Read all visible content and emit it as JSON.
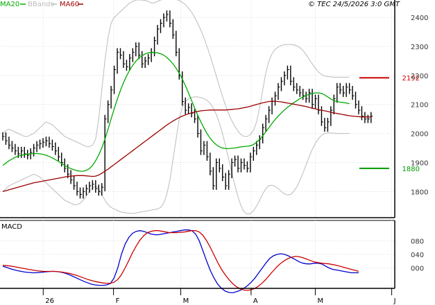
{
  "chart_data": [
    {
      "type": "line",
      "panel": "price",
      "legend": [
        {
          "name": "MA20",
          "color": "#00aa00"
        },
        {
          "name": "BBands",
          "color": "#bbbbbb"
        },
        {
          "name": "MA60",
          "color": "#990000"
        }
      ],
      "copyright": "© TEC 24/5/2026 3:0 GMT",
      "y_ticks": [
        "2400",
        "2300",
        "2200",
        "2100",
        "2000",
        "1900",
        "1800"
      ],
      "y_tick_values": [
        2400,
        2300,
        2200,
        2100,
        2000,
        1900,
        1800
      ],
      "ylim": [
        1710,
        2460
      ],
      "x_ticks": [
        "26",
        "F",
        "M",
        "A",
        "M",
        "J"
      ],
      "x_tick_index": [
        13,
        36,
        58,
        81,
        102,
        127
      ],
      "x_range": [
        0,
        128
      ],
      "grid": true,
      "resistance": {
        "value": 2192,
        "label": "2192",
        "color": "#cc0000"
      },
      "support": {
        "value": 1880,
        "label": "1880",
        "color": "#009900"
      },
      "series": [
        {
          "name": "Price",
          "color": "#000000",
          "values": [
            1990,
            1975,
            1960,
            1950,
            1940,
            1930,
            1940,
            1930,
            1925,
            1935,
            1950,
            1960,
            1965,
            1970,
            1975,
            1965,
            1955,
            1940,
            1920,
            1900,
            1880,
            1860,
            1840,
            1820,
            1800,
            1790,
            1800,
            1810,
            1820,
            1825,
            1810,
            1800,
            1815,
            2050,
            2100,
            2150,
            2220,
            2280,
            2270,
            2240,
            2230,
            2260,
            2280,
            2300,
            2270,
            2240,
            2250,
            2260,
            2280,
            2320,
            2360,
            2380,
            2400,
            2410,
            2380,
            2340,
            2280,
            2200,
            2110,
            2080,
            2090,
            2070,
            2050,
            2000,
            1940,
            1960,
            1920,
            1870,
            1820,
            1900,
            1880,
            1850,
            1820,
            1860,
            1900,
            1910,
            1880,
            1900,
            1890,
            1880,
            1920,
            1940,
            1960,
            1980,
            2020,
            2050,
            2080,
            2110,
            2130,
            2160,
            2180,
            2200,
            2220,
            2180,
            2160,
            2150,
            2140,
            2130,
            2120,
            2140,
            2100,
            2120,
            2080,
            2040,
            2020,
            2040,
            2080,
            2120,
            2160,
            2150,
            2140,
            2160,
            2150,
            2130,
            2100,
            2080,
            2060,
            2050,
            2050,
            2060
          ]
        },
        {
          "name": "MA20",
          "color": "#00aa00",
          "values": [
            1890,
            1898,
            1906,
            1912,
            1918,
            1922,
            1925,
            1927,
            1929,
            1930,
            1931,
            1931,
            1930,
            1928,
            1925,
            1921,
            1916,
            1910,
            1904,
            1897,
            1890,
            1884,
            1879,
            1875,
            1872,
            1870,
            1870,
            1873,
            1879,
            1890,
            1906,
            1926,
            1950,
            1980,
            2015,
            2050,
            2085,
            2118,
            2148,
            2175,
            2198,
            2218,
            2235,
            2249,
            2260,
            2268,
            2274,
            2278,
            2279,
            2279,
            2278,
            2275,
            2270,
            2262,
            2252,
            2240,
            2225,
            2208,
            2188,
            2165,
            2140,
            2114,
            2088,
            2063,
            2040,
            2019,
            2000,
            1984,
            1971,
            1961,
            1954,
            1950,
            1948,
            1948,
            1949,
            1950,
            1952,
            1954,
            1955,
            1956,
            1958,
            1962,
            1970,
            1980,
            1992,
            2006,
            2020,
            2035,
            2048,
            2060,
            2071,
            2081,
            2090,
            2098,
            2106,
            2113,
            2120,
            2126,
            2131,
            2135,
            2138,
            2140,
            2140,
            2138,
            2133,
            2126,
            2119,
            2113,
            2110,
            2108,
            2107,
            2105,
            2103
          ]
        },
        {
          "name": "MA60",
          "color": "#990000",
          "values": [
            1800,
            1803,
            1806,
            1809,
            1812,
            1815,
            1818,
            1821,
            1824,
            1827,
            1830,
            1832,
            1834,
            1836,
            1838,
            1840,
            1842,
            1844,
            1846,
            1848,
            1850,
            1852,
            1853,
            1854,
            1855,
            1855,
            1855,
            1854,
            1853,
            1852,
            1853,
            1857,
            1863,
            1870,
            1877,
            1885,
            1893,
            1901,
            1909,
            1917,
            1925,
            1933,
            1941,
            1949,
            1957,
            1965,
            1973,
            1981,
            1989,
            1997,
            2005,
            2013,
            2021,
            2029,
            2036,
            2043,
            2049,
            2055,
            2060,
            2064,
            2068,
            2071,
            2074,
            2076,
            2078,
            2079,
            2080,
            2081,
            2081,
            2081,
            2081,
            2081,
            2081,
            2082,
            2083,
            2084,
            2085,
            2087,
            2089,
            2091,
            2094,
            2097,
            2100,
            2103,
            2106,
            2108,
            2110,
            2111,
            2111,
            2110,
            2109,
            2107,
            2105,
            2103,
            2101,
            2099,
            2097,
            2095,
            2093,
            2090,
            2087,
            2085,
            2082,
            2080,
            2078,
            2076,
            2073,
            2071,
            2069,
            2067,
            2065,
            2063,
            2061,
            2060,
            2059,
            2058,
            2057,
            2057,
            2057,
            2057
          ]
        },
        {
          "name": "BBands upper",
          "color": "#bbbbbb",
          "values": [
            2000,
            2010,
            2015,
            2010,
            2005,
            2000,
            1995,
            1990,
            1990,
            1995,
            2000,
            2010,
            2020,
            2030,
            2040,
            2035,
            2030,
            2020,
            2010,
            2000,
            1990,
            1985,
            1980,
            1975,
            1970,
            1965,
            1960,
            1955,
            1955,
            1960,
            1980,
            2050,
            2150,
            2250,
            2330,
            2380,
            2400,
            2410,
            2420,
            2430,
            2440,
            2450,
            2455,
            2460,
            2460,
            2460,
            2458,
            2455,
            2450,
            2450,
            2455,
            2460,
            2462,
            2464,
            2465,
            2464,
            2462,
            2458,
            2452,
            2444,
            2432,
            2418,
            2400,
            2380,
            2356,
            2330,
            2300,
            2268,
            2234,
            2198,
            2162,
            2128,
            2096,
            2068,
            2044,
            2024,
            2008,
            1996,
            1990,
            1990,
            1996,
            2010,
            2040,
            2090,
            2150,
            2210,
            2250,
            2275,
            2290,
            2298,
            2303,
            2306,
            2307,
            2307,
            2306,
            2302,
            2296,
            2286,
            2272,
            2256,
            2240,
            2225,
            2212,
            2203,
            2198,
            2196,
            2195,
            2194,
            2194,
            2194,
            2194,
            2194,
            2194
          ]
        },
        {
          "name": "BBands lower",
          "color": "#bbbbbb",
          "values": [
            1800,
            1810,
            1820,
            1825,
            1830,
            1835,
            1840,
            1845,
            1850,
            1855,
            1860,
            1855,
            1850,
            1840,
            1830,
            1820,
            1810,
            1800,
            1790,
            1780,
            1770,
            1765,
            1760,
            1755,
            1755,
            1760,
            1770,
            1785,
            1800,
            1810,
            1820,
            1810,
            1790,
            1770,
            1755,
            1745,
            1740,
            1735,
            1730,
            1728,
            1726,
            1725,
            1725,
            1726,
            1728,
            1730,
            1732,
            1734,
            1736,
            1738,
            1740,
            1745,
            1760,
            1790,
            1840,
            1910,
            1980,
            2050,
            2090,
            2110,
            2120,
            2124,
            2126,
            2126,
            2124,
            2120,
            2114,
            2104,
            2088,
            2066,
            2036,
            1999,
            1957,
            1912,
            1866,
            1822,
            1782,
            1750,
            1730,
            1722,
            1724,
            1734,
            1750,
            1770,
            1792,
            1810,
            1820,
            1822,
            1818,
            1810,
            1800,
            1792,
            1788,
            1790,
            1800,
            1816,
            1838,
            1864,
            1892,
            1920,
            1945,
            1966,
            1982,
            1994,
            2000,
            2002,
            2002,
            2001,
            2000,
            2000,
            2000,
            2000,
            2000
          ]
        }
      ]
    },
    {
      "type": "line",
      "panel": "macd",
      "title": "MACD",
      "y_ticks": [
        "080",
        "040",
        "000"
      ],
      "y_tick_values": [
        80,
        40,
        0
      ],
      "ylim": [
        -60,
        140
      ],
      "grid": true,
      "series": [
        {
          "name": "MACD",
          "color": "#0000cc",
          "values": [
            5,
            2,
            -2,
            -5,
            -8,
            -10,
            -12,
            -13,
            -14,
            -14,
            -13,
            -12,
            -11,
            -10,
            -10,
            -11,
            -13,
            -16,
            -20,
            -25,
            -30,
            -35,
            -40,
            -44,
            -48,
            -50,
            -51,
            -51,
            -50,
            -46,
            -30,
            0,
            40,
            70,
            90,
            102,
            108,
            110,
            108,
            104,
            100,
            98,
            98,
            100,
            102,
            104,
            106,
            108,
            110,
            112,
            112,
            110,
            100,
            80,
            50,
            20,
            -8,
            -30,
            -48,
            -60,
            -68,
            -72,
            -73,
            -70,
            -66,
            -60,
            -52,
            -42,
            -30,
            -15,
            0,
            15,
            28,
            36,
            40,
            42,
            40,
            36,
            30,
            24,
            18,
            14,
            12,
            12,
            14,
            14,
            12,
            6,
            0,
            -4,
            -6,
            -8,
            -10,
            -12,
            -14,
            -14,
            -14
          ]
        },
        {
          "name": "Signal",
          "color": "#cc0000",
          "values": [
            8,
            7,
            6,
            4,
            2,
            0,
            -2,
            -4,
            -6,
            -8,
            -9,
            -10,
            -10,
            -10,
            -10,
            -11,
            -12,
            -14,
            -16,
            -19,
            -22,
            -26,
            -30,
            -34,
            -37,
            -40,
            -42,
            -44,
            -45,
            -45,
            -42,
            -34,
            -20,
            0,
            22,
            45,
            65,
            82,
            95,
            104,
            108,
            110,
            110,
            108,
            106,
            104,
            104,
            104,
            105,
            106,
            108,
            110,
            110,
            106,
            96,
            80,
            60,
            38,
            16,
            -4,
            -20,
            -34,
            -46,
            -55,
            -61,
            -65,
            -66,
            -64,
            -60,
            -53,
            -44,
            -33,
            -20,
            -8,
            4,
            14,
            22,
            28,
            32,
            34,
            33,
            30,
            26,
            22,
            18,
            16,
            14,
            13,
            12,
            10,
            8,
            5,
            2,
            -1,
            -4,
            -7,
            -10
          ]
        }
      ]
    }
  ]
}
